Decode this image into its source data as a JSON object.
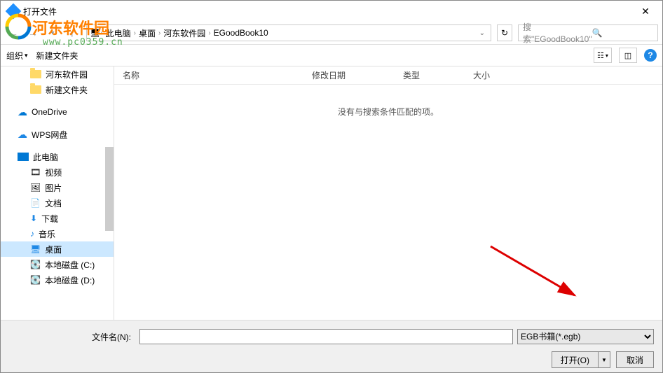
{
  "window": {
    "title": "打开文件"
  },
  "breadcrumb": {
    "items": [
      "此电脑",
      "桌面",
      "河东软件园",
      "EGoodBook10"
    ]
  },
  "search": {
    "placeholder": "搜索\"EGoodBook10\""
  },
  "toolbar": {
    "organize": "组织",
    "newfolder": "新建文件夹"
  },
  "sidebar": {
    "items": [
      {
        "label": "河东软件园",
        "type": "folder",
        "sub": true
      },
      {
        "label": "新建文件夹",
        "type": "folder",
        "sub": true
      },
      {
        "label": "OneDrive",
        "type": "onedrive",
        "sub": false
      },
      {
        "label": "WPS网盘",
        "type": "wps",
        "sub": false
      },
      {
        "label": "此电脑",
        "type": "pc",
        "sub": false
      },
      {
        "label": "视频",
        "type": "video",
        "sub": true
      },
      {
        "label": "图片",
        "type": "picture",
        "sub": true
      },
      {
        "label": "文档",
        "type": "doc",
        "sub": true
      },
      {
        "label": "下载",
        "type": "download",
        "sub": true
      },
      {
        "label": "音乐",
        "type": "music",
        "sub": true
      },
      {
        "label": "桌面",
        "type": "desktop",
        "sub": true,
        "selected": true
      },
      {
        "label": "本地磁盘 (C:)",
        "type": "disk",
        "sub": true
      },
      {
        "label": "本地磁盘 (D:)",
        "type": "disk",
        "sub": true
      }
    ]
  },
  "columns": {
    "name": "名称",
    "modified": "修改日期",
    "type": "类型",
    "size": "大小"
  },
  "main": {
    "empty": "没有与搜索条件匹配的项。"
  },
  "footer": {
    "filename_label": "文件名(N):",
    "filename_value": "",
    "filter": "EGB书籍(*.egb)",
    "open": "打开(O)",
    "cancel": "取消"
  },
  "watermark": {
    "text": "河东软件园",
    "url": "www.pc0359.cn"
  }
}
